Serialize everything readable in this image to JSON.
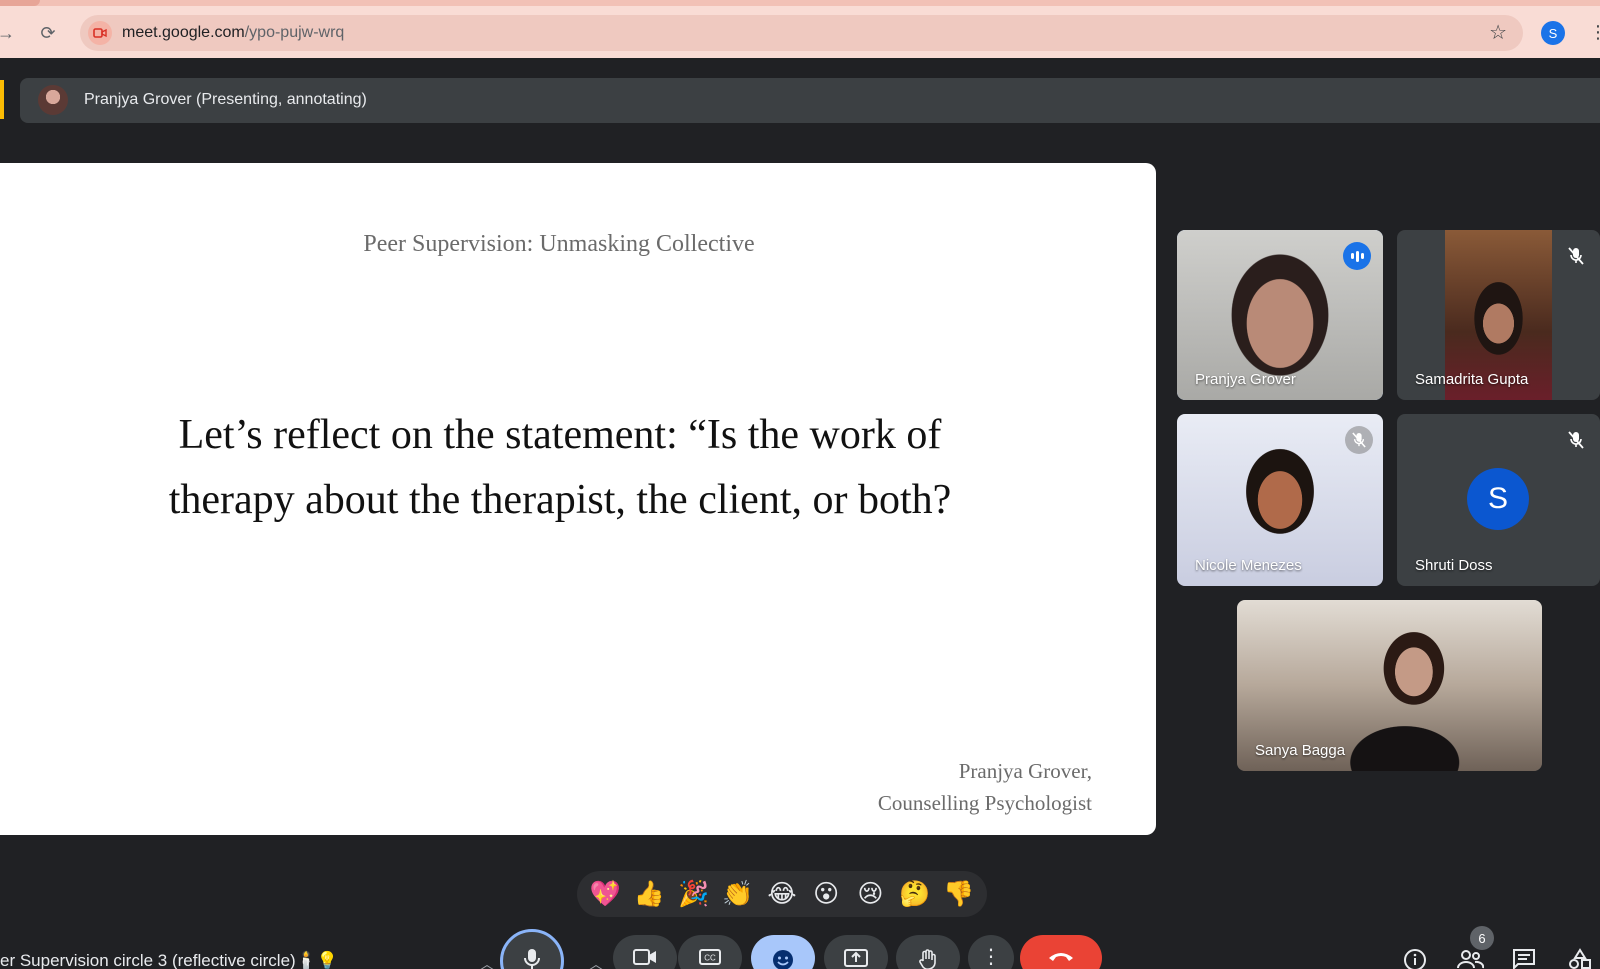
{
  "browser": {
    "url_host": "meet.google.com",
    "url_path": "/ypo-pujw-wrq",
    "profile_initial": "S"
  },
  "presenter_banner": {
    "text": "Pranjya Grover (Presenting, annotating)"
  },
  "slide": {
    "title": "Peer Supervision: Unmasking Collective",
    "body": "Let’s reflect on the statement: “Is the work of therapy about the therapist, the client, or both?",
    "author_name": "Pranjya Grover,",
    "author_role": "Counselling Psychologist"
  },
  "participants": [
    {
      "name": "Pranjya Grover",
      "state": "speaking"
    },
    {
      "name": "Samadrita Gupta",
      "state": "muted"
    },
    {
      "name": "Nicole Menezes",
      "state": "muted"
    },
    {
      "name": "Shruti Doss",
      "state": "muted",
      "avatar_initial": "S"
    },
    {
      "name": "Sanya Bagga",
      "state": "unmuted"
    }
  ],
  "reactions": [
    "💖",
    "👍",
    "🎉",
    "👏",
    "😂",
    "😮",
    "😢",
    "🤔",
    "👎"
  ],
  "meeting_title": "er Supervision circle 3 (reflective circle)🕯️💡",
  "people_count": "6",
  "colors": {
    "speaking_outline": "#8ab4f8",
    "end_call": "#ea4335",
    "active_control": "#a8c7fa",
    "presenter_accent": "#fbbc04"
  }
}
